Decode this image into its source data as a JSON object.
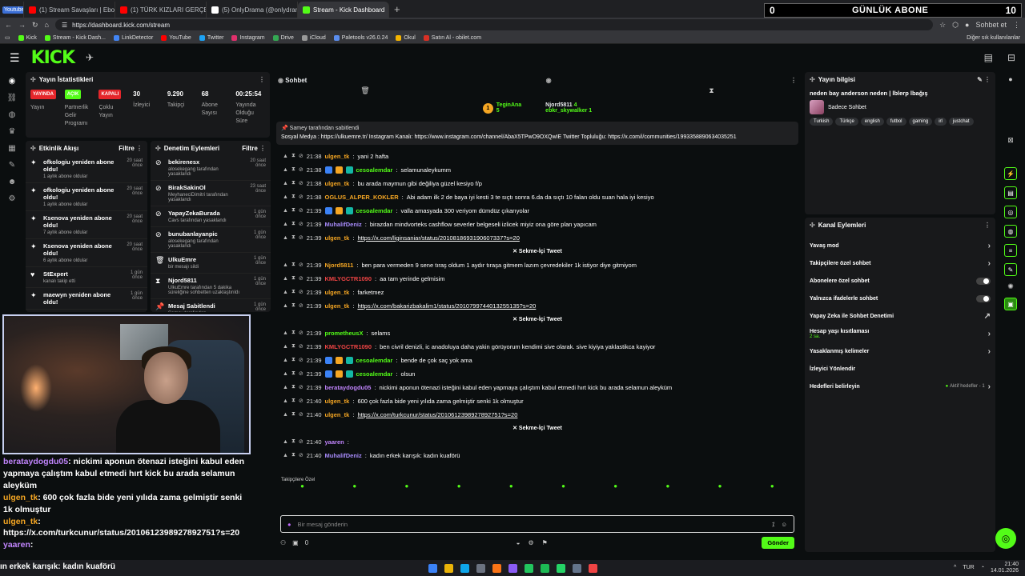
{
  "browser": {
    "tabs": [
      {
        "label": "Youtube",
        "color": "#3b6fd6"
      },
      {
        "label": "(1) Stream Savaşları | Ebo x Uzi - Y",
        "color": "#ff0000"
      },
      {
        "label": "(1) TÜRK KIZLARI GERÇEKTEN \"KE",
        "color": "#ff0000"
      },
      {
        "label": "(5) OnlyDrama (@onlydramaX) / X",
        "color": "#ffffff"
      },
      {
        "label": "Stream - Kick Dashboard",
        "color": "#53fc18"
      }
    ],
    "url": "https://dashboard.kick.com/stream",
    "right_label": "Sohbet et",
    "bookmarks": [
      "Kick",
      "Stream - Kick Dash...",
      "LinkDetector",
      "YouTube",
      "Twitter",
      "Instagram",
      "Drive",
      "iCloud",
      "Paletools v26.0.24",
      "Okul",
      "Satın Al - obilet.com"
    ],
    "bookmark_colors": [
      "#53fc18",
      "#53fc18",
      "#4285f4",
      "#ff0000",
      "#1da1f2",
      "#e1306c",
      "#34a853",
      "#999999",
      "#5a8dee",
      "#f4b400",
      "#d93025"
    ],
    "other_bookmarks": "Diğer sık kullanılanlar"
  },
  "overlay_sub": {
    "left": "0",
    "title": "GÜNLÜK ABONE",
    "right": "10"
  },
  "kick": {
    "logo": "KICK"
  },
  "stats": {
    "title": "Yayın İstatistikleri",
    "items": [
      {
        "badge": "YAYINDA",
        "badge_color": "#e5262b",
        "label": "Yayın"
      },
      {
        "badge": "AÇIK",
        "badge_color": "#53fc18",
        "label": "Partnerlik Gelir Programı"
      },
      {
        "badge": "KAPALI",
        "badge_color": "#e5262b",
        "label": "Çoklu Yayın"
      },
      {
        "num": "30",
        "label": "İzleyici"
      },
      {
        "num": "9.290",
        "label": "Takipçi"
      },
      {
        "num": "68",
        "label": "Abone Sayısı"
      },
      {
        "num": "00:25:54",
        "label": "Yayında Olduğu Süre"
      }
    ]
  },
  "activity": {
    "title": "Etkinlik Akışı",
    "filter": "Filtre",
    "items": [
      {
        "text": "ofkologiu yeniden abone oldu!",
        "sub": "1 aylık abone oldular",
        "time": "20 saat önce"
      },
      {
        "text": "ofkologiu yeniden abone oldu!",
        "sub": "1 aylık abone oldular",
        "time": "20 saat önce"
      },
      {
        "text": "Ksenova yeniden abone oldu!",
        "sub": "7 aylık abone oldular",
        "time": "20 saat önce"
      },
      {
        "text": "Ksenova yeniden abone oldu!",
        "sub": "6 aylık abone oldular",
        "time": "20 saat önce"
      },
      {
        "text": "StExpert",
        "sub": "kanalı takip etti",
        "time": "1 gün önce"
      },
      {
        "text": "maewyn yeniden abone oldu!",
        "sub": "",
        "time": "1 gün önce"
      }
    ]
  },
  "moderation": {
    "title": "Denetim Eylemleri",
    "filter": "Filtre",
    "items": [
      {
        "text": "bekirenesx",
        "sub": "alosekegang tarafından yasaklandı",
        "time": "20 saat önce"
      },
      {
        "text": "BirakSakinOl",
        "sub": "MeyhaneciDimitri tarafından yasaklandı",
        "time": "23 saat önce"
      },
      {
        "text": "YapayZekaBurada",
        "sub": "Cavs tarafından yasaklandı",
        "time": "1 gün önce"
      },
      {
        "text": "bunubanlayanpic",
        "sub": "alosekegang tarafından yasaklandı",
        "time": "1 gün önce"
      },
      {
        "text": "UlkuEmre",
        "sub": "bir mesajı sildi",
        "time": "1 gün önce"
      },
      {
        "text": "Njord5811",
        "sub": "UlkuEmre tarafından 5 dakika süreliğine sohbetten uzaklaştırıldı",
        "time": "1 gün önce"
      },
      {
        "text": "Mesaj Sabitlendi",
        "sub": "Samey tarafından",
        "time": "1 gün önce"
      }
    ]
  },
  "overlay_chat": [
    {
      "user": "berataydogdu05",
      "color": "#c084fc",
      "text": ": nickimi aponun ötenazi isteğini kabul eden yapmaya çalıştım kabul etmedi hırt kick bu arada selamun aleyküm"
    },
    {
      "user": "ulgen_tk",
      "color": "#f5a623",
      "text": ": 600 çok fazla bide yeni yılıda zama gelmiştir senki 1k olmuştur"
    },
    {
      "user": "ulgen_tk",
      "color": "#f5a623",
      "text": ": https://x.com/turkcunur/status/2010612398927892751?s=20"
    },
    {
      "user": "yaaren",
      "color": "#c084fc",
      "text": ":"
    }
  ],
  "ticker": "ın erkek karışık: kadın kuaförü",
  "chat": {
    "title": "Sohbet",
    "leaders": [
      {
        "rank": "1",
        "name": "TeginAna",
        "count": "5"
      },
      {
        "name": "Njord5811",
        "count": "4"
      },
      {
        "name": "ebkr_skywalker",
        "count": "1"
      }
    ],
    "pinned_by": "Samey tarafından sabitlendi",
    "pinned_text": "Sosyal Medya : https://ulkuemre.tr/ Instagram Kanalı: https://www.instagram.com/channel/AbaX5TPwO9OXQwIE Twitter Topluluğu: https://x.com/i/communities/1993358890634035251",
    "messages": [
      {
        "time": "21:38",
        "user": "ulgen_tk",
        "color": "#f5a623",
        "text": "yani 2 hafta"
      },
      {
        "time": "21:38",
        "user": "cesoalemdar",
        "color": "#53fc18",
        "text": "selamunaleykumm"
      },
      {
        "time": "21:38",
        "user": "ulgen_tk",
        "color": "#f5a623",
        "text": "bu arada maymun gibi değiliya güzel kesiyo f/p"
      },
      {
        "time": "21:38",
        "user": "OGLUS_ALPER_KOKLER",
        "color": "#f5a623",
        "text": "Abi adam ilk 2 de baya iyi kesti 3 te sıçtı sonra 6.da da sıçtı 10 falan oldu suan hala iyi kesiyo"
      },
      {
        "time": "21:39",
        "user": "cesoalemdar",
        "color": "#53fc18",
        "text": "valla amasyada 300 veriyom dümdüz çıkarıyolar"
      },
      {
        "time": "21:39",
        "user": "MuhalifDeniz",
        "color": "#a78bfa",
        "text": "birazdan mindvorteks cashflow severler belgeseli izlicek miyiz ona göre plan yapıcam"
      },
      {
        "time": "21:39",
        "user": "ulgen_tk",
        "color": "#f5a623",
        "text": "https://x.com/liginsaniar/status/2010818693190607337?s=20",
        "link": true
      },
      {
        "tweet": "Sekme-İçi Tweet"
      },
      {
        "time": "21:39",
        "user": "Njord5811",
        "color": "#f5a623",
        "text": "ben para vermeden 9 sene tıraş oldum 1 aydır tıraşa gitmem lazım çevredekiler 1k istiyor diye gitmiyom"
      },
      {
        "time": "21:39",
        "user": "KMLYGCTR1090",
        "color": "#ef4444",
        "text": "aa tam yerinde gelmisim"
      },
      {
        "time": "21:39",
        "user": "ulgen_tk",
        "color": "#f5a623",
        "text": "farketmez"
      },
      {
        "time": "21:39",
        "user": "ulgen_tk",
        "color": "#f5a623",
        "text": "https://x.com/bakarizbakalim1/status/2010799744013255135?s=20",
        "link": true
      },
      {
        "tweet": "Sekme-İçi Tweet"
      },
      {
        "time": "21:39",
        "user": "prometheusX",
        "color": "#53fc18",
        "text": "selams"
      },
      {
        "time": "21:39",
        "user": "KMLYGCTR1090",
        "color": "#ef4444",
        "text": "ben civril denizli, ic anadoluya daha yakin görüyorum kendimi sive olarak. sive kiyiya yaklastikca kayiyor"
      },
      {
        "time": "21:39",
        "user": "cesoalemdar",
        "color": "#53fc18",
        "text": "bende de çok saç yok ama"
      },
      {
        "time": "21:39",
        "user": "cesoalemdar",
        "color": "#53fc18",
        "text": "olsun"
      },
      {
        "time": "21:39",
        "user": "berataydogdu05",
        "color": "#c084fc",
        "text": "nickimi aponun ötenazi isteğini kabul eden yapmaya çalıştım kabul etmedi hırt kick bu arada selamun aleyküm"
      },
      {
        "time": "21:40",
        "user": "ulgen_tk",
        "color": "#f5a623",
        "text": "600 çok fazla bide yeni yılıda zama gelmiştir senki 1k olmuştur"
      },
      {
        "time": "21:40",
        "user": "ulgen_tk",
        "color": "#f5a623",
        "text": "https://x.com/turkcunur/status/2010612398927892751?s=20",
        "link": true
      },
      {
        "tweet": "Sekme-İçi Tweet"
      },
      {
        "time": "21:40",
        "user": "yaaren",
        "color": "#c084fc",
        "text": ""
      },
      {
        "time": "21:40",
        "user": "MuhalifDeniz",
        "color": "#a78bfa",
        "text": "kadın erkek karışık: kadın kuaförü"
      }
    ],
    "followers_only": "Takipçilere Özel",
    "input_placeholder": "Bir mesaj gönderin",
    "bottom_count": "0",
    "send": "Gönder"
  },
  "stream_info": {
    "title": "Yayın bilgisi",
    "stream_title": "neden bay anderson neden | lblerp lbağış",
    "category": "Sadece Sohbet",
    "tags": [
      "Turkish",
      "Türkçe",
      "english",
      "futbol",
      "gaming",
      "irl",
      "justchat"
    ]
  },
  "channel_actions": {
    "title": "Kanal Eylemleri",
    "rows": [
      {
        "label": "Yavaş mod",
        "ctl": "chev"
      },
      {
        "label": "Takipçilere özel sohbet",
        "ctl": "chev"
      },
      {
        "label": "Abonelere özel sohbet",
        "ctl": "toggle"
      },
      {
        "label": "Yalnızca ifadelerle sohbet",
        "ctl": "toggle"
      },
      {
        "label": "Yapay Zeka ile Sohbet Denetimi",
        "ctl": "ext"
      },
      {
        "label": "Hesap yaşı kısıtlaması",
        "sub": "2 sa.",
        "ctl": "chev"
      },
      {
        "label": "Yasaklanmış kelimeler",
        "ctl": "chev"
      },
      {
        "label": "İzleyici Yönlendir",
        "ctl": ""
      },
      {
        "label": "Hedefleri belirleyin",
        "ctl": "chev",
        "extra": "Aktif hedefler - 1"
      }
    ]
  },
  "taskbar": {
    "lang": "TUR",
    "time": "21:40",
    "date": "14.01.2026",
    "icons": [
      "#3b82f6",
      "#eab308",
      "#0ea5e9",
      "#6b7280",
      "#f97316",
      "#8b5cf6",
      "#22c55e",
      "#1db954",
      "#25d366",
      "#64748b",
      "#ef4444"
    ]
  }
}
